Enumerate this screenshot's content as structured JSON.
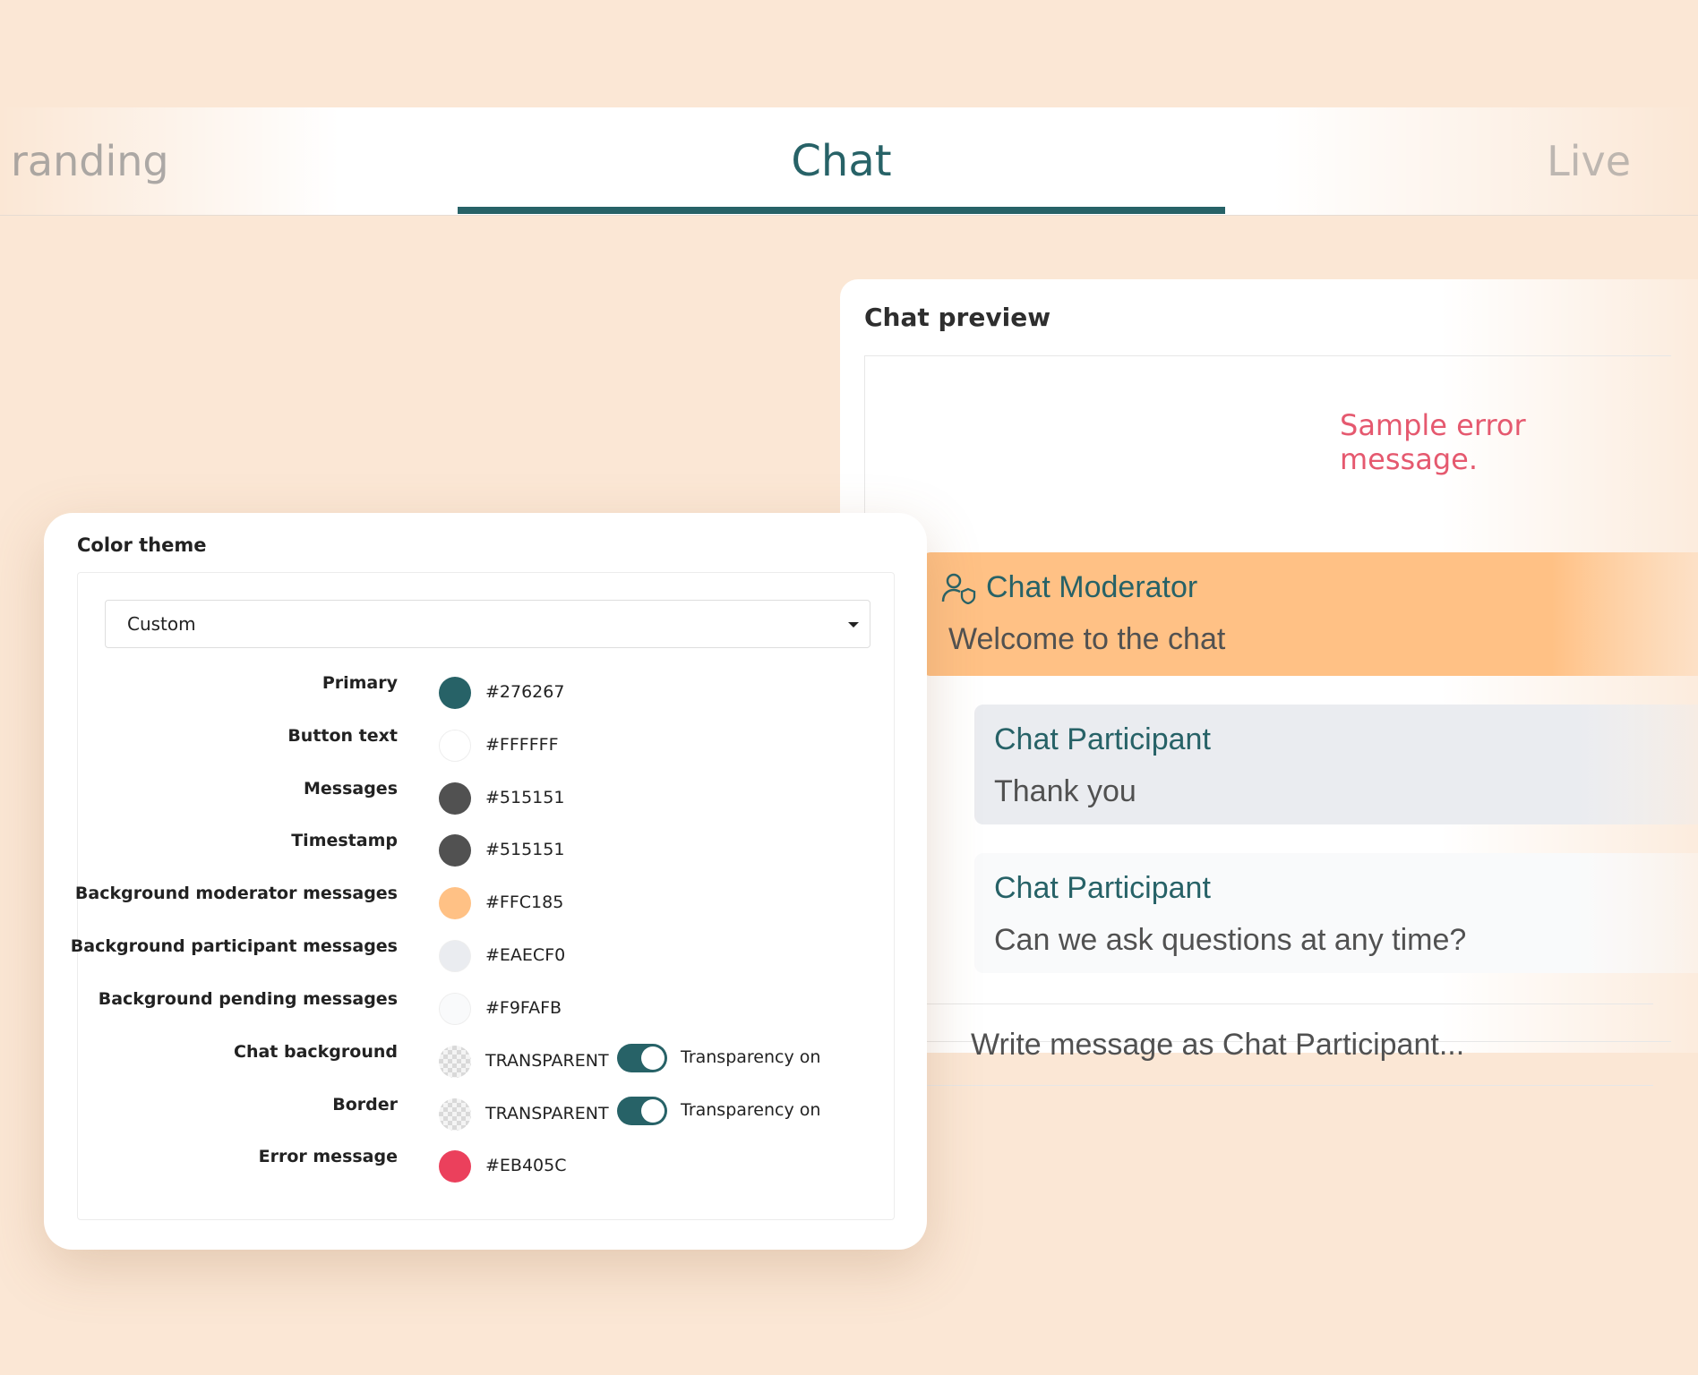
{
  "tabs": {
    "branding": "randing",
    "chat": "Chat",
    "live": "Live"
  },
  "preview": {
    "title": "Chat preview",
    "error_message": "Sample error message.",
    "messages": [
      {
        "name": "Chat Moderator",
        "text": "Welcome to the chat",
        "role": "moderator"
      },
      {
        "name": "Chat Participant",
        "text": "Thank you",
        "role": "participant"
      },
      {
        "name": "Chat Participant",
        "text": "Can we ask questions at any time?",
        "role": "pending"
      }
    ],
    "input_placeholder": "Write message as Chat Participant..."
  },
  "color_theme": {
    "title": "Color theme",
    "selected_theme": "Custom",
    "rows": [
      {
        "label": "Primary",
        "value": "#276267",
        "color": "#276267"
      },
      {
        "label": "Button text",
        "value": "#FFFFFF",
        "color": "#FFFFFF"
      },
      {
        "label": "Messages",
        "value": "#515151",
        "color": "#515151"
      },
      {
        "label": "Timestamp",
        "value": "#515151",
        "color": "#515151"
      },
      {
        "label": "Background moderator messages",
        "value": "#FFC185",
        "color": "#FFC185"
      },
      {
        "label": "Background participant messages",
        "value": "#EAECF0",
        "color": "#EAECF0"
      },
      {
        "label": "Background pending messages",
        "value": "#F9FAFB",
        "color": "#F9FAFB"
      },
      {
        "label": "Chat background",
        "value": "TRANSPARENT",
        "toggle_label": "Transparency on",
        "toggle_on": true
      },
      {
        "label": "Border",
        "value": "TRANSPARENT",
        "toggle_label": "Transparency on",
        "toggle_on": true
      },
      {
        "label": "Error message",
        "value": "#EB405C",
        "color": "#EB405C"
      }
    ]
  },
  "colors": {
    "accent": "#276267",
    "page_background": "#fbe7d5",
    "error": "#EB405C"
  },
  "icons": {
    "moderator": "moderator-shield-user-icon",
    "dropdown": "caret-down-icon"
  }
}
